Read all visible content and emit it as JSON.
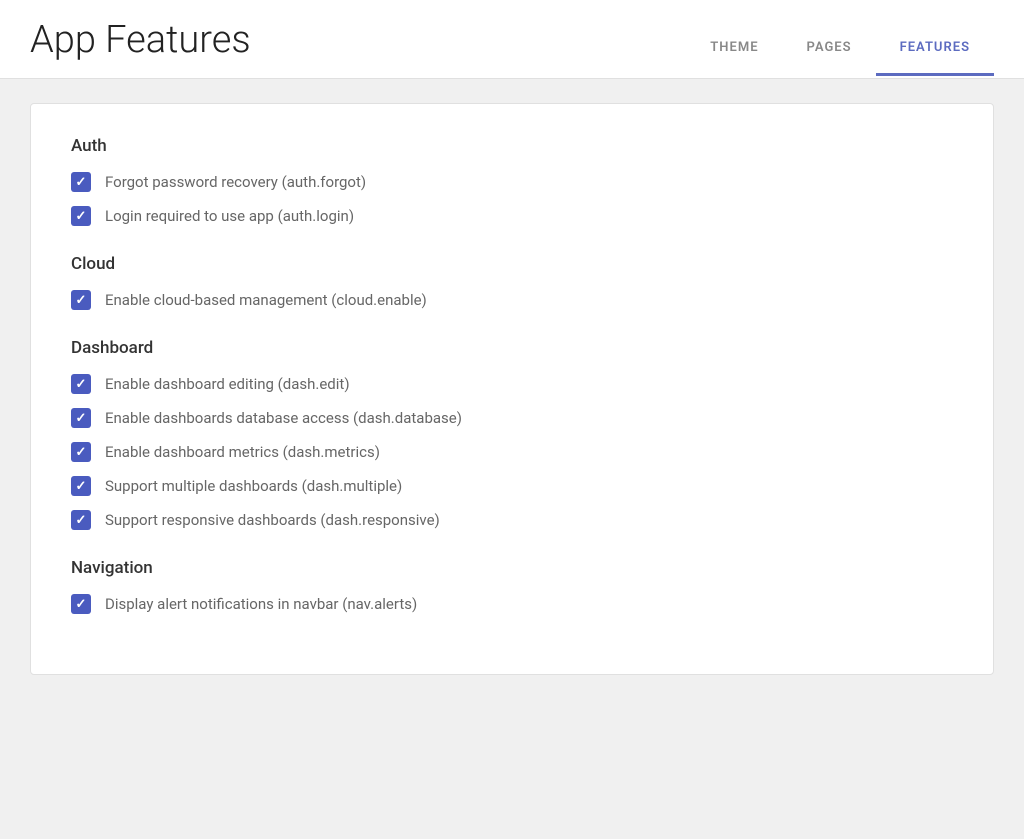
{
  "header": {
    "title": "App Features",
    "nav": [
      {
        "label": "THEME",
        "active": false
      },
      {
        "label": "PAGES",
        "active": false
      },
      {
        "label": "FEATURES",
        "active": true
      }
    ]
  },
  "sections": [
    {
      "title": "Auth",
      "items": [
        {
          "label": "Forgot password recovery (auth.forgot)",
          "checked": true
        },
        {
          "label": "Login required to use app (auth.login)",
          "checked": true
        }
      ]
    },
    {
      "title": "Cloud",
      "items": [
        {
          "label": "Enable cloud-based management (cloud.enable)",
          "checked": true
        }
      ]
    },
    {
      "title": "Dashboard",
      "items": [
        {
          "label": "Enable dashboard editing (dash.edit)",
          "checked": true
        },
        {
          "label": "Enable dashboards database access (dash.database)",
          "checked": true
        },
        {
          "label": "Enable dashboard metrics (dash.metrics)",
          "checked": true
        },
        {
          "label": "Support multiple dashboards (dash.multiple)",
          "checked": true
        },
        {
          "label": "Support responsive dashboards (dash.responsive)",
          "checked": true
        }
      ]
    },
    {
      "title": "Navigation",
      "items": [
        {
          "label": "Display alert notifications in navbar (nav.alerts)",
          "checked": true
        }
      ]
    }
  ],
  "colors": {
    "checkbox_bg": "#4a5bbf",
    "active_nav": "#5c6bc0"
  }
}
